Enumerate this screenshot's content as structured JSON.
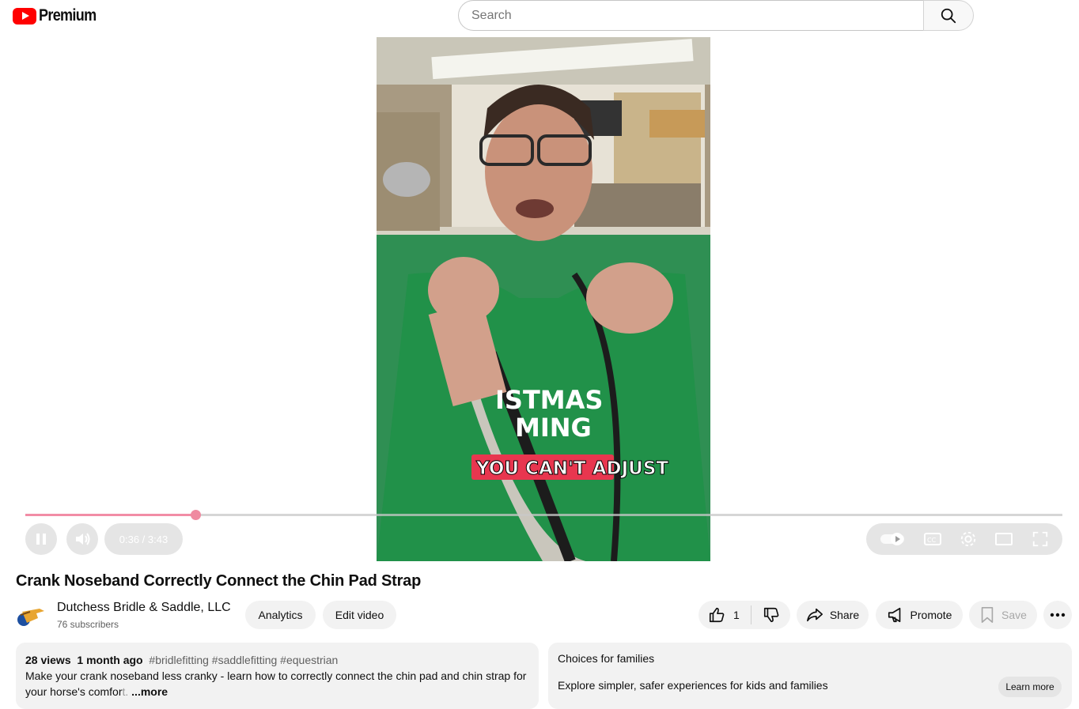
{
  "header": {
    "logo_text": "Premium",
    "search_placeholder": "Search"
  },
  "player": {
    "time_display": "0:36 / 3:43",
    "progress_fraction": 0.164,
    "caption_overlay": "YOU CAN'T ADJUST",
    "shirt_text_line1": "ISTMAS",
    "shirt_text_line2": "MING"
  },
  "video": {
    "title": "Crank Noseband Correctly Connect the Chin Pad Strap",
    "channel_name": "Dutchess Bridle & Saddle, LLC",
    "subscribers": "76 subscribers"
  },
  "actions": {
    "analytics": "Analytics",
    "edit_video": "Edit video",
    "like_count": "1",
    "share": "Share",
    "promote": "Promote",
    "save": "Save"
  },
  "description": {
    "views": "28 views",
    "age": "1 month ago",
    "hashtags": "#bridlefitting #saddlefitting #equestrian",
    "text_main": "Make your crank noseband less cranky - learn how to correctly connect the chin pad and chin strap for your horse's comfor",
    "text_fade": "t.",
    "more": "...more"
  },
  "families_panel": {
    "title": "Choices for families",
    "text": "Explore simpler, safer experiences for kids and families",
    "learn_more": "Learn more"
  },
  "colors": {
    "brand_red": "#ff0000",
    "progress": "#f28da6",
    "caption_bg": "#e8364f"
  }
}
